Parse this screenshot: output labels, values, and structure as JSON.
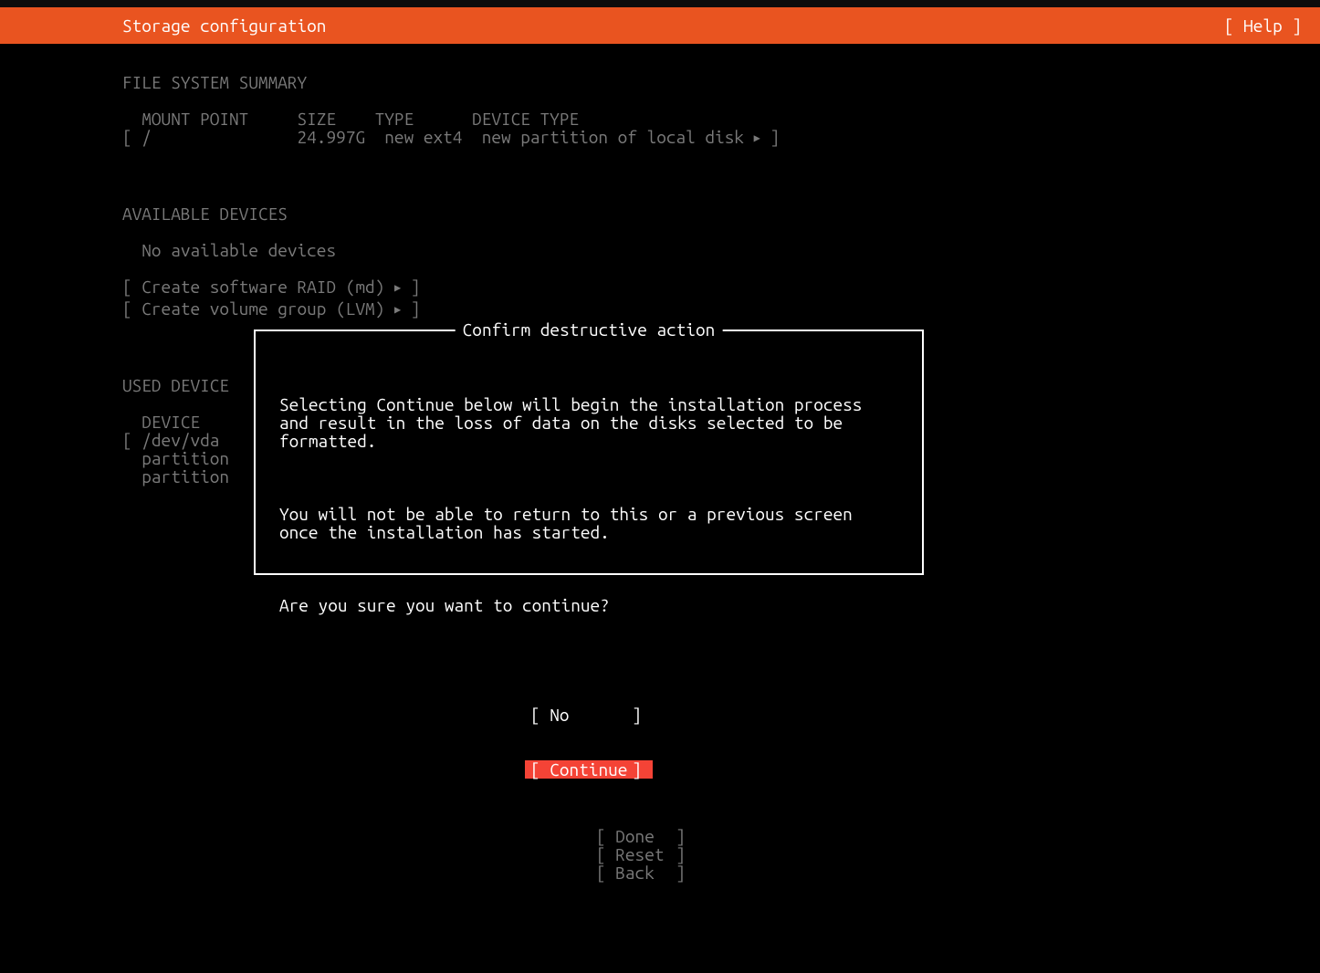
{
  "header": {
    "title": "Storage configuration",
    "help": "Help"
  },
  "fs": {
    "heading": "FILE SYSTEM SUMMARY",
    "cols": {
      "mount": "MOUNT POINT",
      "size": "SIZE",
      "type": "TYPE",
      "devtype": "DEVICE TYPE"
    },
    "row": {
      "mount": "/",
      "size": "24.997G",
      "type": "new ext4",
      "devtype": "new partition of local disk"
    }
  },
  "avail": {
    "heading": "AVAILABLE DEVICES",
    "none": "No available devices",
    "raid": "Create software RAID (md)",
    "lvm": "Create volume group (LVM)"
  },
  "used": {
    "heading": "USED DEVICE",
    "col": "DEVICE",
    "dev": "/dev/vda",
    "p1": "partition",
    "p2": "partition"
  },
  "dialog": {
    "title": "Confirm destructive action",
    "para1": "Selecting Continue below will begin the installation process and result in the loss of data on the disks selected to be formatted.",
    "para2": "You will not be able to return to this or a previous screen once the installation has started.",
    "para3": "Are you sure you want to continue?",
    "no": "No",
    "cont": "Continue"
  },
  "footer": {
    "done": "Done",
    "reset": "Reset",
    "back": "Back"
  }
}
